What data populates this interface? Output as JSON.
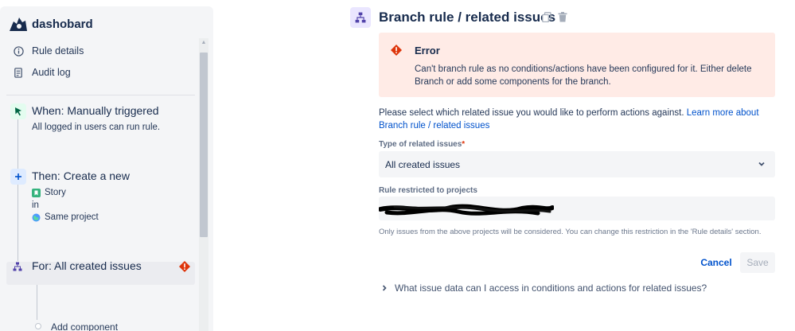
{
  "sidebar": {
    "brand": "dashobard",
    "nav": [
      {
        "label": "Rule details",
        "icon": "info-icon"
      },
      {
        "label": "Audit log",
        "icon": "document-icon"
      }
    ],
    "trigger": {
      "title": "When: Manually triggered",
      "text": "All logged in users can run rule."
    },
    "action": {
      "title": "Then: Create a new",
      "issue_type": "Story",
      "in": "in",
      "project": "Same project"
    },
    "branch": {
      "title": "For: All created issues"
    },
    "add_component": "Add component"
  },
  "header": {
    "title": "Branch rule / related issues"
  },
  "error": {
    "title": "Error",
    "message": "Can't branch rule as no conditions/actions have been configured for it. Either delete Branch or add some components for the branch."
  },
  "description": {
    "text": "Please select which related issue you would like to perform actions against. ",
    "link": "Learn more about Branch rule / related issues"
  },
  "form": {
    "type_label": "Type of related issues",
    "type_required": "*",
    "type_value": "All created issues",
    "projects_label": "Rule restricted to projects",
    "hint": "Only issues from the above projects will be considered. You can change this restriction in the 'Rule details' section."
  },
  "buttons": {
    "cancel": "Cancel",
    "save": "Save"
  },
  "faq": {
    "label": "What issue data can I access in conditions and actions for related issues?"
  },
  "colors": {
    "accent": "#0052cc",
    "error_bg": "#ffebe6",
    "error_icon": "#de350b",
    "sidebar_bg": "#f4f5f7"
  }
}
